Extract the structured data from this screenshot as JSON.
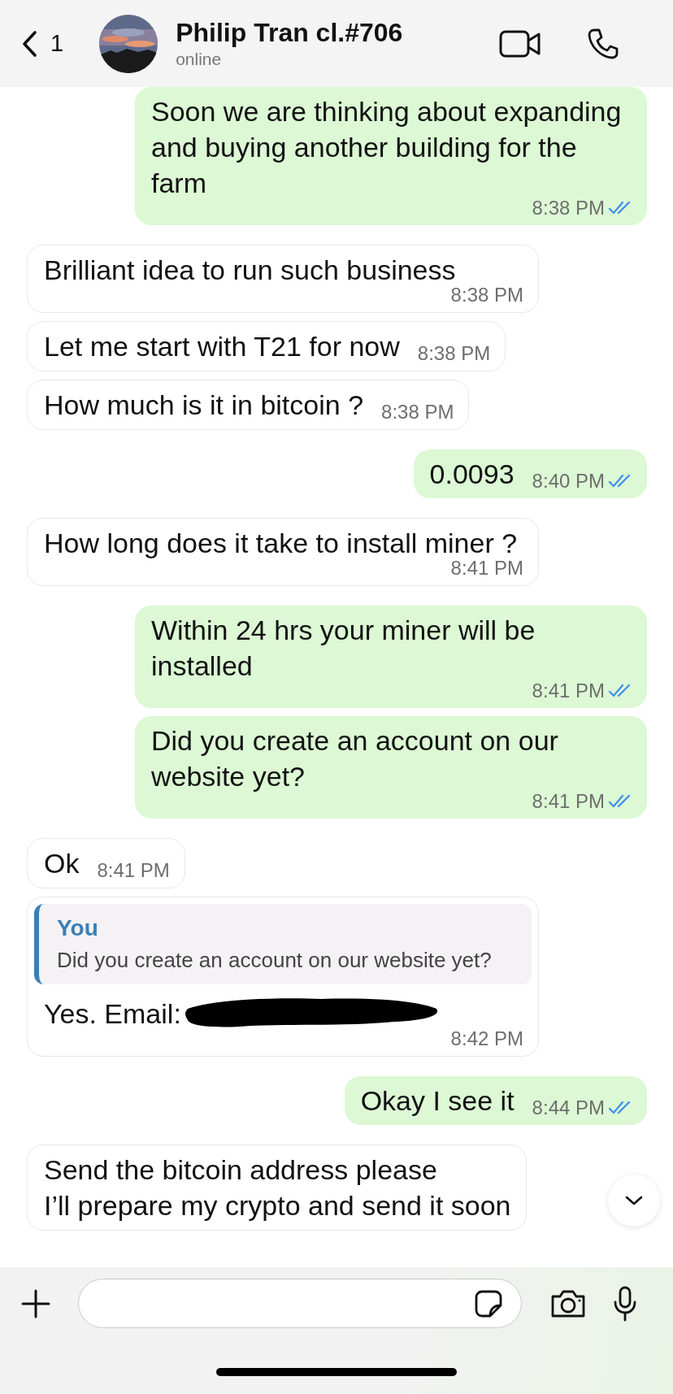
{
  "header": {
    "back_count": "1",
    "contact_name": "Philip Tran cl.#706",
    "status": "online"
  },
  "messages": [
    {
      "kind": "outgoing",
      "text": "Soon we are thinking about expanding and buying another building for the farm",
      "time": "8:38 PM",
      "read": true
    },
    {
      "kind": "incoming",
      "text": "Brilliant idea to run such business",
      "time": "8:38 PM"
    },
    {
      "kind": "incoming",
      "text": "Let me start with T21 for now",
      "time": "8:38 PM"
    },
    {
      "kind": "incoming",
      "text": "How much is it in bitcoin ?",
      "time": "8:38 PM"
    },
    {
      "kind": "outgoing",
      "text": "0.0093",
      "time": "8:40 PM",
      "read": true
    },
    {
      "kind": "incoming",
      "text": "How long does it take to install miner ?",
      "time": "8:41 PM"
    },
    {
      "kind": "outgoing",
      "text": "Within 24 hrs your miner will be installed",
      "time": "8:41 PM",
      "read": true
    },
    {
      "kind": "outgoing",
      "text": "Did you create an account on our website yet?",
      "time": "8:41 PM",
      "read": true
    },
    {
      "kind": "incoming",
      "text": "Ok",
      "time": "8:41 PM"
    },
    {
      "kind": "incoming",
      "quote": {
        "author": "You",
        "text": "Did you create an account on our website yet?"
      },
      "text": "Yes. Email:",
      "redacted": true,
      "time": "8:42 PM"
    },
    {
      "kind": "outgoing",
      "text": "Okay I see it",
      "time": "8:44 PM",
      "read": true
    },
    {
      "kind": "incoming",
      "text": "Send the bitcoin address please\nI’ll prepare my crypto and send it soon"
    }
  ]
}
